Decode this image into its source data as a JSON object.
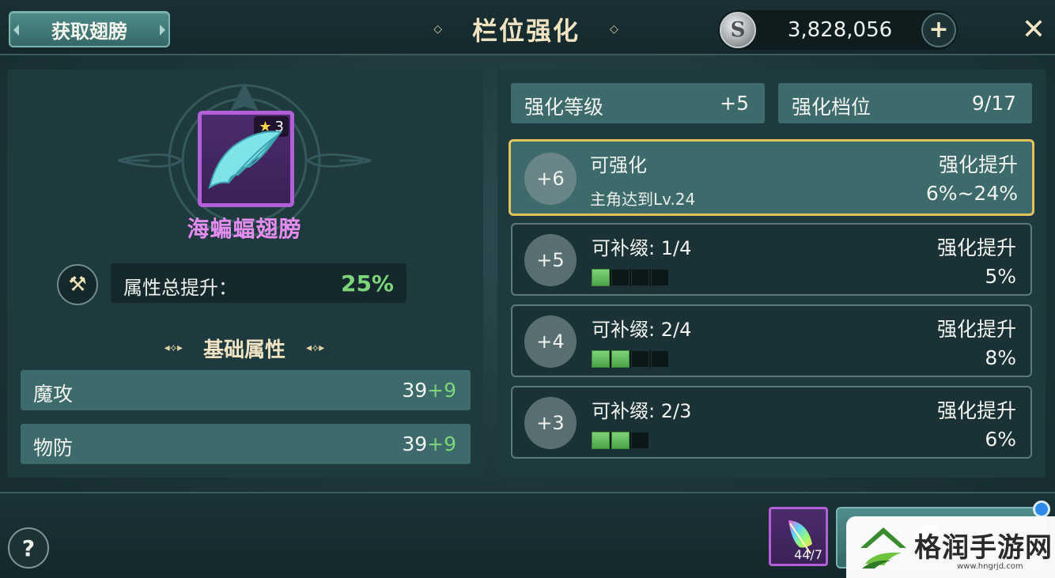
{
  "header": {
    "get_wings_label": "获取翅膀",
    "title": "栏位强化",
    "currency_amount": "3,828,056",
    "currency_icon_letter": "S",
    "add_symbol": "+",
    "close_symbol": "✕"
  },
  "item": {
    "name": "海蝙蝠翅膀",
    "stars": "3",
    "rarity_color": "#b35fd8"
  },
  "attributes": {
    "total_label": "属性总提升：",
    "total_value": "25%",
    "section_title": "基础属性",
    "stats": [
      {
        "name": "魔攻",
        "base": "39",
        "bonus": "+9"
      },
      {
        "name": "物防",
        "base": "39",
        "bonus": "+9"
      }
    ]
  },
  "enhance": {
    "level_label": "强化等级",
    "level_value": "+5",
    "tier_label": "强化档位",
    "tier_value": "9/17",
    "boost_label": "强化提升",
    "tiers": [
      {
        "badge": "+6",
        "status": "可强化",
        "sub": "主角达到Lv.24",
        "boost": "6%~24%",
        "active": true
      },
      {
        "badge": "+5",
        "status": "可补缀: 1/4",
        "boost": "5%",
        "filled": 1,
        "total": 4
      },
      {
        "badge": "+4",
        "status": "可补缀: 2/4",
        "boost": "8%",
        "filled": 2,
        "total": 4
      },
      {
        "badge": "+3",
        "status": "可补缀: 2/3",
        "boost": "6%",
        "filled": 2,
        "total": 3
      }
    ]
  },
  "footer": {
    "help_symbol": "?",
    "material_count": "44/7"
  },
  "watermark": {
    "name": "格润手游网",
    "url": "www.hngrjd.com"
  },
  "colors": {
    "accent_gold": "#e2c45a",
    "progress_green": "#7dd47a",
    "purple_rarity": "#b35fd8"
  }
}
